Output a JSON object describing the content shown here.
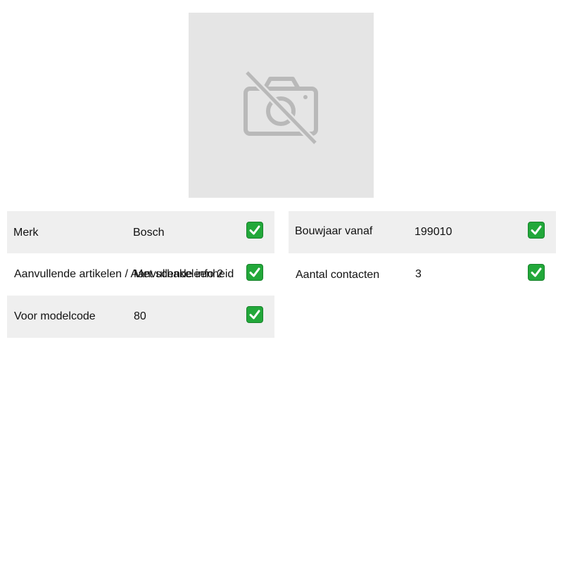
{
  "product_image": {
    "icon": "camera-off-icon",
    "background": "#e5e5e5"
  },
  "specs_left": [
    {
      "label": "Merk",
      "value": "Bosch",
      "check_icon": "check-mark-icon"
    },
    {
      "label": "Aanvullende artikelen / Aanvullende info 2",
      "value": "Met schakeleenheid",
      "check_icon": "check-mark-icon"
    },
    {
      "label": "Voor modelcode",
      "value": "80",
      "check_icon": "check-mark-icon"
    }
  ],
  "specs_right": [
    {
      "label": "Bouwjaar vanaf",
      "value": "199010",
      "check_icon": "check-mark-icon"
    },
    {
      "label": "Aantal contacten",
      "value": "3",
      "check_icon": "check-mark-icon"
    }
  ],
  "colors": {
    "row_shaded": "#efefef",
    "check_green": "#22a83a"
  }
}
